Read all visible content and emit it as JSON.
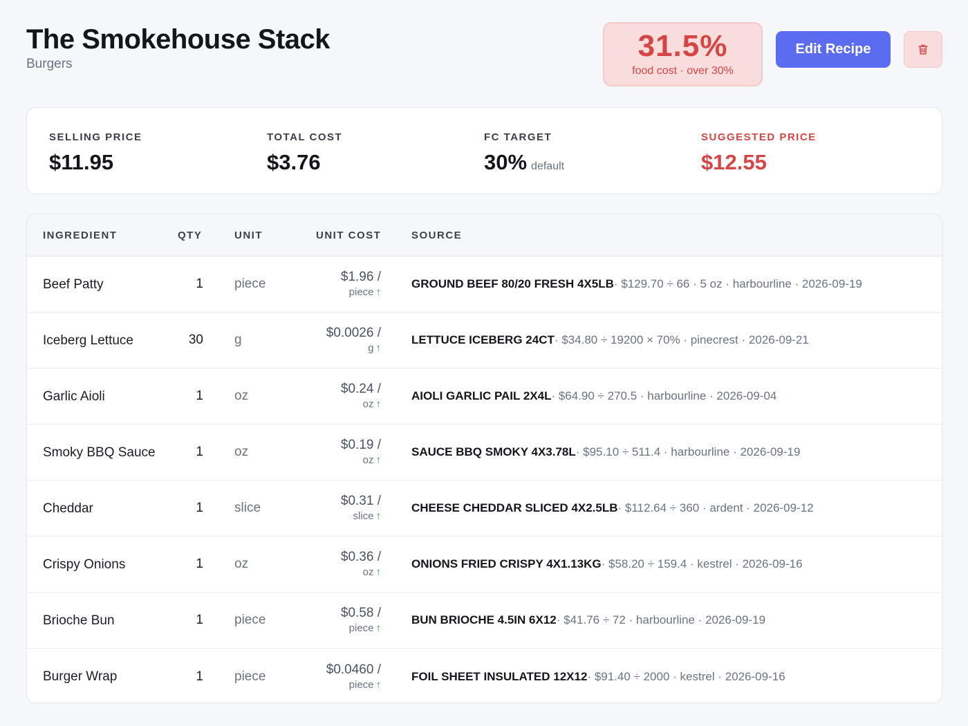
{
  "header": {
    "title": "The Smokehouse Stack",
    "subtitle": "Burgers"
  },
  "food_cost": {
    "value": "31.5%",
    "label": "food cost · over 30%",
    "color": "#d64545"
  },
  "actions": {
    "edit_label": "Edit Recipe",
    "delete_icon": "trash-icon",
    "accent": "#5b6cf0"
  },
  "summary": {
    "selling_price": {
      "label": "SELLING PRICE",
      "value": "$11.95"
    },
    "total_cost": {
      "label": "TOTAL COST",
      "value": "$3.76"
    },
    "fc_target": {
      "label": "FC TARGET",
      "value": "30%",
      "note": "default"
    },
    "suggested_price": {
      "label": "SUGGESTED PRICE",
      "value": "$12.55"
    }
  },
  "table": {
    "columns": [
      "INGREDIENT",
      "QTY",
      "UNIT",
      "UNIT COST",
      "SOURCE"
    ],
    "rows": [
      {
        "name": "Beef Patty",
        "qty": "1",
        "unit": "piece",
        "cost": "$1.96 /",
        "cost_unit": "piece",
        "trend": "↑",
        "source_name": "GROUND BEEF 80/20 FRESH 4X5LB",
        "source_detail": " · $129.70 ÷ 66 · 5 oz · harbourline · 2026-09-19"
      },
      {
        "name": "Iceberg Lettuce",
        "qty": "30",
        "unit": "g",
        "cost": "$0.0026 /",
        "cost_unit": "g",
        "trend": "↑",
        "source_name": "LETTUCE ICEBERG 24CT",
        "source_detail": " · $34.80 ÷ 19200 × 70% · pinecrest · 2026-09-21"
      },
      {
        "name": "Garlic Aioli",
        "qty": "1",
        "unit": "oz",
        "cost": "$0.24 /",
        "cost_unit": "oz",
        "trend": "↑",
        "source_name": "AIOLI GARLIC PAIL 2X4L",
        "source_detail": " · $64.90 ÷ 270.5 · harbourline · 2026-09-04"
      },
      {
        "name": "Smoky BBQ Sauce",
        "qty": "1",
        "unit": "oz",
        "cost": "$0.19 /",
        "cost_unit": "oz",
        "trend": "↑",
        "source_name": "SAUCE BBQ SMOKY 4X3.78L",
        "source_detail": " · $95.10 ÷ 511.4 · harbourline · 2026-09-19"
      },
      {
        "name": "Cheddar",
        "qty": "1",
        "unit": "slice",
        "cost": "$0.31 /",
        "cost_unit": "slice",
        "trend": "↑",
        "source_name": "CHEESE CHEDDAR SLICED 4X2.5LB",
        "source_detail": " · $112.64 ÷ 360 · ardent · 2026-09-12"
      },
      {
        "name": "Crispy Onions",
        "qty": "1",
        "unit": "oz",
        "cost": "$0.36 /",
        "cost_unit": "oz",
        "trend": "↑",
        "source_name": "ONIONS FRIED CRISPY 4X1.13KG",
        "source_detail": " · $58.20 ÷ 159.4 · kestrel · 2026-09-16"
      },
      {
        "name": "Brioche Bun",
        "qty": "1",
        "unit": "piece",
        "cost": "$0.58 /",
        "cost_unit": "piece",
        "trend": "↑",
        "source_name": "BUN BRIOCHE 4.5IN 6X12",
        "source_detail": " · $41.76 ÷ 72 · harbourline · 2026-09-19"
      },
      {
        "name": "Burger Wrap",
        "qty": "1",
        "unit": "piece",
        "cost": "$0.0460 /",
        "cost_unit": "piece",
        "trend": "↑",
        "source_name": "FOIL SHEET INSULATED 12X12",
        "source_detail": " · $91.40 ÷ 2000 · kestrel · 2026-09-16"
      }
    ]
  }
}
